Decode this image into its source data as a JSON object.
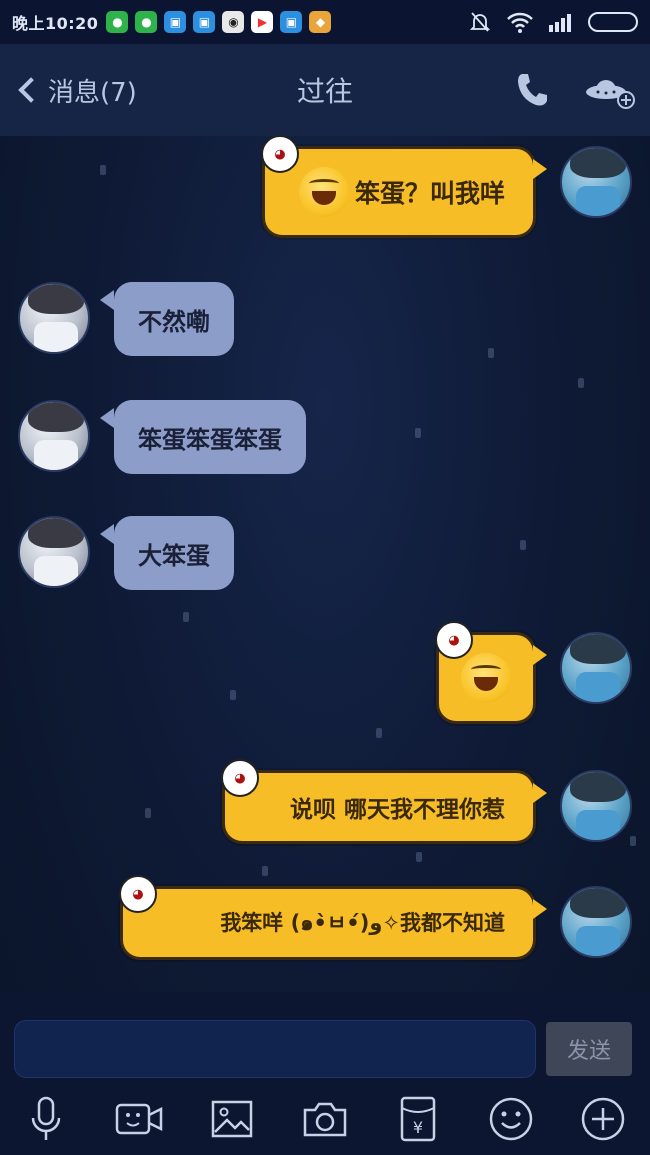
{
  "status_bar": {
    "time": "晚上10:20",
    "notification_icons": [
      "wechat-icon",
      "wechat-icon",
      "app-icon",
      "app-icon",
      "panda-icon",
      "play-store-icon",
      "app-icon",
      "gallery-icon"
    ],
    "system_icons": [
      "mute-bell-icon",
      "wifi-icon",
      "signal-icon",
      "battery-icon"
    ]
  },
  "header": {
    "back_label": "消息(7)",
    "title": "过往",
    "phone_icon": "phone-icon",
    "more_icon": "ufo-add-icon"
  },
  "messages": [
    {
      "sender": "me",
      "has_emoji": true,
      "text": "笨蛋？叫我咩"
    },
    {
      "sender": "other",
      "has_emoji": false,
      "text": "不然嘞"
    },
    {
      "sender": "other",
      "has_emoji": false,
      "text": "笨蛋笨蛋笨蛋"
    },
    {
      "sender": "other",
      "has_emoji": false,
      "text": "大笨蛋"
    },
    {
      "sender": "me",
      "has_emoji": true,
      "text": ""
    },
    {
      "sender": "me",
      "has_emoji": false,
      "text": "说呗 哪天我不理你惹"
    },
    {
      "sender": "me",
      "has_emoji": false,
      "text": "我笨咩 (๑•̀ㅂ•́)و✧我都不知道"
    }
  ],
  "input": {
    "value": "",
    "placeholder": "",
    "send_label": "发送"
  },
  "toolbar": {
    "icons": [
      "microphone-icon",
      "video-icon",
      "image-icon",
      "camera-icon",
      "red-packet-icon",
      "emoji-icon",
      "plus-icon"
    ]
  },
  "colors": {
    "background": "#0f1a33",
    "my_bubble": "#f6bd27",
    "their_bubble": "#8b9dc8",
    "header": "#162545"
  }
}
